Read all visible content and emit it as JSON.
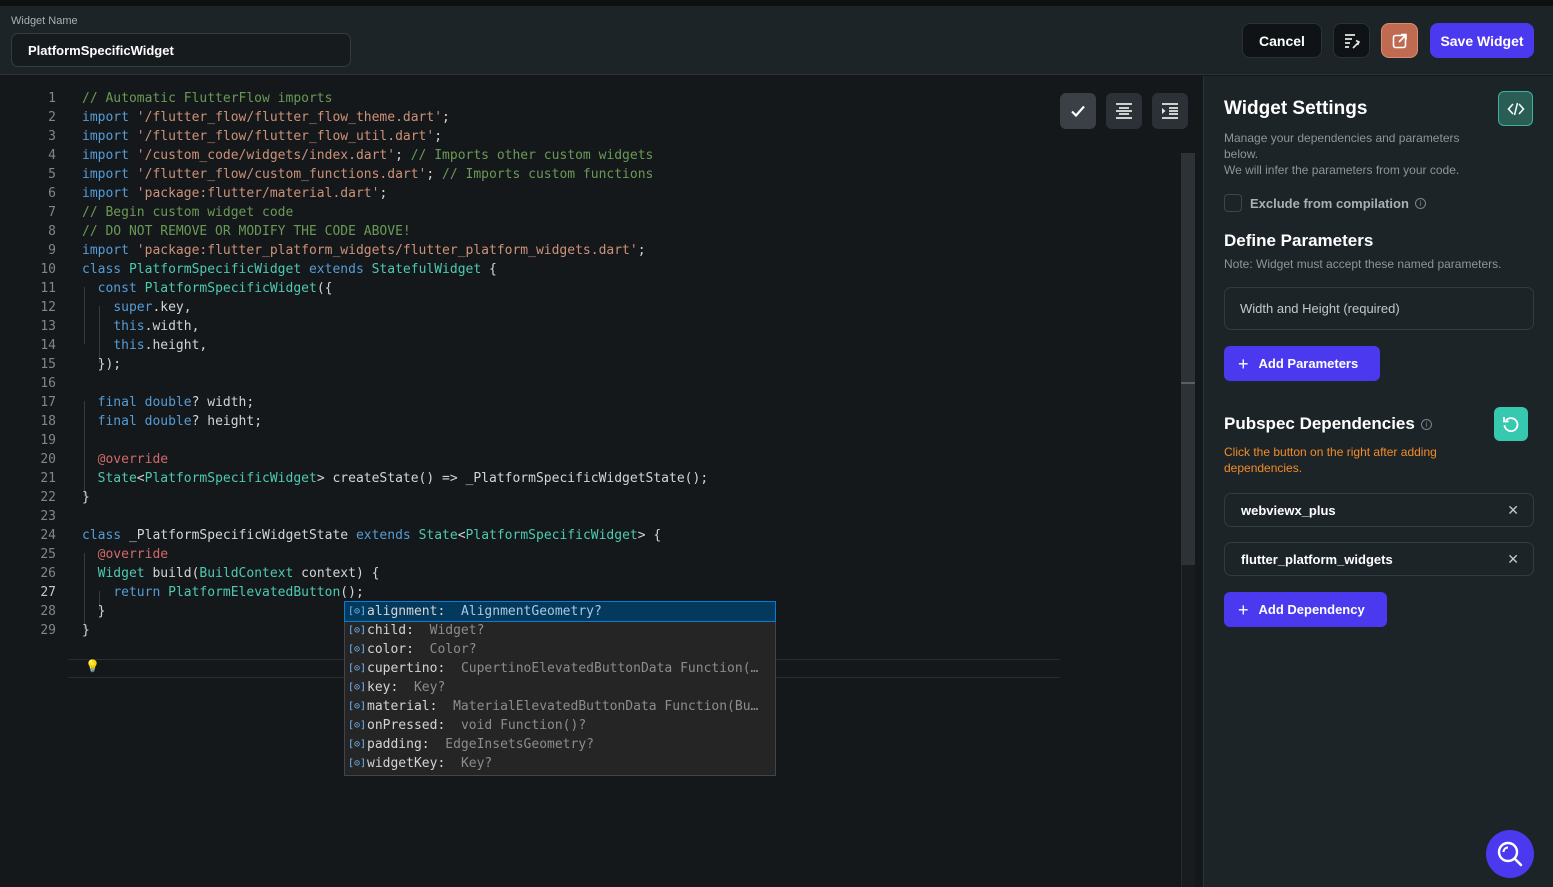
{
  "header": {
    "widget_name_label": "Widget Name",
    "widget_name_value": "PlatformSpecificWidget",
    "cancel_label": "Cancel",
    "save_label": "Save Widget"
  },
  "editor": {
    "lines": [
      {
        "n": "1",
        "segments": [
          {
            "t": "// Automatic FlutterFlow imports",
            "c": "com"
          }
        ]
      },
      {
        "n": "2",
        "segments": [
          {
            "t": "import",
            "c": "kw"
          },
          {
            "t": " ",
            "c": "p"
          },
          {
            "t": "'/flutter_flow/flutter_flow_theme.dart'",
            "c": "str"
          },
          {
            "t": ";",
            "c": "p"
          }
        ]
      },
      {
        "n": "3",
        "segments": [
          {
            "t": "import",
            "c": "kw"
          },
          {
            "t": " ",
            "c": "p"
          },
          {
            "t": "'/flutter_flow/flutter_flow_util.dart'",
            "c": "str"
          },
          {
            "t": ";",
            "c": "p"
          }
        ]
      },
      {
        "n": "4",
        "segments": [
          {
            "t": "import",
            "c": "kw"
          },
          {
            "t": " ",
            "c": "p"
          },
          {
            "t": "'/custom_code/widgets/index.dart'",
            "c": "str"
          },
          {
            "t": "; ",
            "c": "p"
          },
          {
            "t": "// Imports other custom widgets",
            "c": "com"
          }
        ]
      },
      {
        "n": "5",
        "segments": [
          {
            "t": "import",
            "c": "kw"
          },
          {
            "t": " ",
            "c": "p"
          },
          {
            "t": "'/flutter_flow/custom_functions.dart'",
            "c": "str"
          },
          {
            "t": "; ",
            "c": "p"
          },
          {
            "t": "// Imports custom functions",
            "c": "com"
          }
        ]
      },
      {
        "n": "6",
        "segments": [
          {
            "t": "import",
            "c": "kw"
          },
          {
            "t": " ",
            "c": "p"
          },
          {
            "t": "'package:flutter/material.dart'",
            "c": "str"
          },
          {
            "t": ";",
            "c": "p"
          }
        ]
      },
      {
        "n": "7",
        "segments": [
          {
            "t": "// Begin custom widget code",
            "c": "com"
          }
        ]
      },
      {
        "n": "8",
        "segments": [
          {
            "t": "// DO NOT REMOVE OR MODIFY THE CODE ABOVE!",
            "c": "com"
          }
        ]
      },
      {
        "n": "9",
        "segments": [
          {
            "t": "import",
            "c": "kw"
          },
          {
            "t": " ",
            "c": "p"
          },
          {
            "t": "'package:flutter_platform_widgets/flutter_platform_widgets.dart'",
            "c": "str"
          },
          {
            "t": ";",
            "c": "p"
          }
        ]
      },
      {
        "n": "10",
        "segments": [
          {
            "t": "class",
            "c": "kw"
          },
          {
            "t": " ",
            "c": "p"
          },
          {
            "t": "PlatformSpecificWidget",
            "c": "type"
          },
          {
            "t": " ",
            "c": "p"
          },
          {
            "t": "extends",
            "c": "kw"
          },
          {
            "t": " ",
            "c": "p"
          },
          {
            "t": "StatefulWidget",
            "c": "type"
          },
          {
            "t": " {",
            "c": "p"
          }
        ]
      },
      {
        "n": "11",
        "segments": [
          {
            "t": "  ",
            "c": "p"
          },
          {
            "t": "const",
            "c": "kw"
          },
          {
            "t": " ",
            "c": "p"
          },
          {
            "t": "PlatformSpecificWidget",
            "c": "type"
          },
          {
            "t": "({",
            "c": "p"
          }
        ]
      },
      {
        "n": "12",
        "segments": [
          {
            "t": "    ",
            "c": "p"
          },
          {
            "t": "super",
            "c": "kw"
          },
          {
            "t": ".key,",
            "c": "p"
          }
        ]
      },
      {
        "n": "13",
        "segments": [
          {
            "t": "    ",
            "c": "p"
          },
          {
            "t": "this",
            "c": "kw"
          },
          {
            "t": ".width,",
            "c": "p"
          }
        ]
      },
      {
        "n": "14",
        "segments": [
          {
            "t": "    ",
            "c": "p"
          },
          {
            "t": "this",
            "c": "kw"
          },
          {
            "t": ".height,",
            "c": "p"
          }
        ]
      },
      {
        "n": "15",
        "segments": [
          {
            "t": "  });",
            "c": "p"
          }
        ]
      },
      {
        "n": "16",
        "segments": []
      },
      {
        "n": "17",
        "segments": [
          {
            "t": "  ",
            "c": "p"
          },
          {
            "t": "final",
            "c": "kw"
          },
          {
            "t": " ",
            "c": "p"
          },
          {
            "t": "double",
            "c": "kw"
          },
          {
            "t": "? width;",
            "c": "p"
          }
        ]
      },
      {
        "n": "18",
        "segments": [
          {
            "t": "  ",
            "c": "p"
          },
          {
            "t": "final",
            "c": "kw"
          },
          {
            "t": " ",
            "c": "p"
          },
          {
            "t": "double",
            "c": "kw"
          },
          {
            "t": "? height;",
            "c": "p"
          }
        ]
      },
      {
        "n": "19",
        "segments": []
      },
      {
        "n": "20",
        "segments": [
          {
            "t": "  ",
            "c": "p"
          },
          {
            "t": "@override",
            "c": "ann"
          }
        ]
      },
      {
        "n": "21",
        "segments": [
          {
            "t": "  ",
            "c": "p"
          },
          {
            "t": "State",
            "c": "type"
          },
          {
            "t": "<",
            "c": "p"
          },
          {
            "t": "PlatformSpecificWidget",
            "c": "type"
          },
          {
            "t": "> createState() => _PlatformSpecificWidgetState();",
            "c": "p"
          }
        ]
      },
      {
        "n": "22",
        "segments": [
          {
            "t": "}",
            "c": "p"
          }
        ]
      },
      {
        "n": "23",
        "segments": []
      },
      {
        "n": "24",
        "segments": [
          {
            "t": "class",
            "c": "kw"
          },
          {
            "t": " _PlatformSpecificWidgetState ",
            "c": "p"
          },
          {
            "t": "extends",
            "c": "kw"
          },
          {
            "t": " ",
            "c": "p"
          },
          {
            "t": "State",
            "c": "type"
          },
          {
            "t": "<",
            "c": "p"
          },
          {
            "t": "PlatformSpecificWidget",
            "c": "type"
          },
          {
            "t": "> {",
            "c": "p"
          }
        ]
      },
      {
        "n": "25",
        "segments": [
          {
            "t": "  ",
            "c": "p"
          },
          {
            "t": "@override",
            "c": "ann"
          }
        ]
      },
      {
        "n": "26",
        "segments": [
          {
            "t": "  ",
            "c": "p"
          },
          {
            "t": "Widget",
            "c": "type"
          },
          {
            "t": " build(",
            "c": "p"
          },
          {
            "t": "BuildContext",
            "c": "type"
          },
          {
            "t": " context) {",
            "c": "p"
          }
        ]
      },
      {
        "n": "27",
        "segments": [
          {
            "t": "    ",
            "c": "p"
          },
          {
            "t": "return",
            "c": "kw"
          },
          {
            "t": " ",
            "c": "p"
          },
          {
            "t": "PlatformElevatedButton",
            "c": "type"
          },
          {
            "t": "();",
            "c": "p"
          }
        ]
      },
      {
        "n": "28",
        "segments": [
          {
            "t": "  }",
            "c": "p"
          }
        ]
      },
      {
        "n": "29",
        "segments": [
          {
            "t": "}",
            "c": "p"
          }
        ]
      }
    ],
    "active_line": "27",
    "suggestions": [
      {
        "name": "alignment:",
        "type": "AlignmentGeometry?"
      },
      {
        "name": "child:",
        "type": "Widget?"
      },
      {
        "name": "color:",
        "type": "Color?"
      },
      {
        "name": "cupertino:",
        "type": "CupertinoElevatedButtonData Function(…"
      },
      {
        "name": "key:",
        "type": "Key?"
      },
      {
        "name": "material:",
        "type": "MaterialElevatedButtonData Function(Bu…"
      },
      {
        "name": "onPressed:",
        "type": "void Function()?"
      },
      {
        "name": "padding:",
        "type": "EdgeInsetsGeometry?"
      },
      {
        "name": "widgetKey:",
        "type": "Key?"
      }
    ],
    "suggestion_icon": "[⊝]"
  },
  "panel": {
    "title": "Widget Settings",
    "desc_line1": "Manage your dependencies and parameters below.",
    "desc_line2": "We will infer the parameters from your code.",
    "exclude_label": "Exclude from compilation",
    "define_title": "Define Parameters",
    "define_note": "Note: Widget must accept these named parameters.",
    "param_item": "Width and Height (required)",
    "add_param_label": "Add Parameters",
    "pubspec_title": "Pubspec Dependencies",
    "pubspec_warning": "Click the button on the right after adding dependencies.",
    "dependencies": [
      "webviewx_plus",
      "flutter_platform_widgets"
    ],
    "add_dep_label": "Add Dependency"
  },
  "colors": {
    "kw": "#569cd6",
    "str": "#ce9178",
    "com": "#6a9955",
    "type": "#4ec9b0",
    "ann": "#d16969",
    "p": "#d4d4d4",
    "accent": "#4b39ef",
    "teal": "#37c9b0",
    "warn": "#f28c28"
  }
}
